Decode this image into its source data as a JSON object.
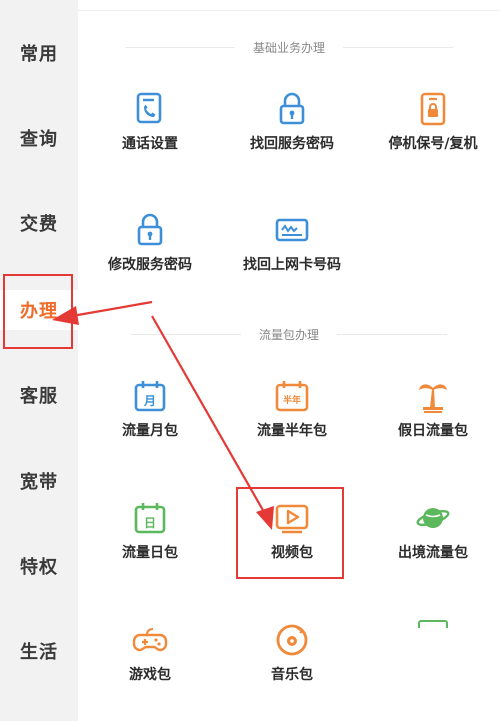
{
  "sidebar": {
    "items": [
      {
        "label": "常用"
      },
      {
        "label": "查询"
      },
      {
        "label": "交费"
      },
      {
        "label": "办理"
      },
      {
        "label": "客服"
      },
      {
        "label": "宽带"
      },
      {
        "label": "特权"
      },
      {
        "label": "生活"
      }
    ],
    "active_index": 3
  },
  "sections": [
    {
      "title": "基础业务办理",
      "items": [
        {
          "label": "通话设置",
          "icon": "phone-settings-icon"
        },
        {
          "label": "找回服务密码",
          "icon": "lock-icon"
        },
        {
          "label": "停机保号/复机",
          "icon": "phone-lock-icon"
        },
        {
          "label": "修改服务密码",
          "icon": "lock-icon"
        },
        {
          "label": "找回上网卡号码",
          "icon": "sim-card-icon"
        }
      ]
    },
    {
      "title": "流量包办理",
      "items": [
        {
          "label": "流量月包",
          "icon": "calendar-month-icon",
          "badge": "月"
        },
        {
          "label": "流量半年包",
          "icon": "calendar-halfyear-icon",
          "badge": "半年"
        },
        {
          "label": "假日流量包",
          "icon": "palm-tree-icon"
        },
        {
          "label": "流量日包",
          "icon": "calendar-day-icon",
          "badge": "日"
        },
        {
          "label": "视频包",
          "icon": "video-play-icon"
        },
        {
          "label": "出境流量包",
          "icon": "planet-icon"
        },
        {
          "label": "游戏包",
          "icon": "gamepad-icon"
        },
        {
          "label": "音乐包",
          "icon": "music-disc-icon"
        }
      ]
    }
  ],
  "colors": {
    "blue": "#3d8fd8",
    "orange": "#f08a3a",
    "green": "#5cb85c",
    "annotation_red": "#e53935",
    "active_text": "#ef6b2a"
  }
}
